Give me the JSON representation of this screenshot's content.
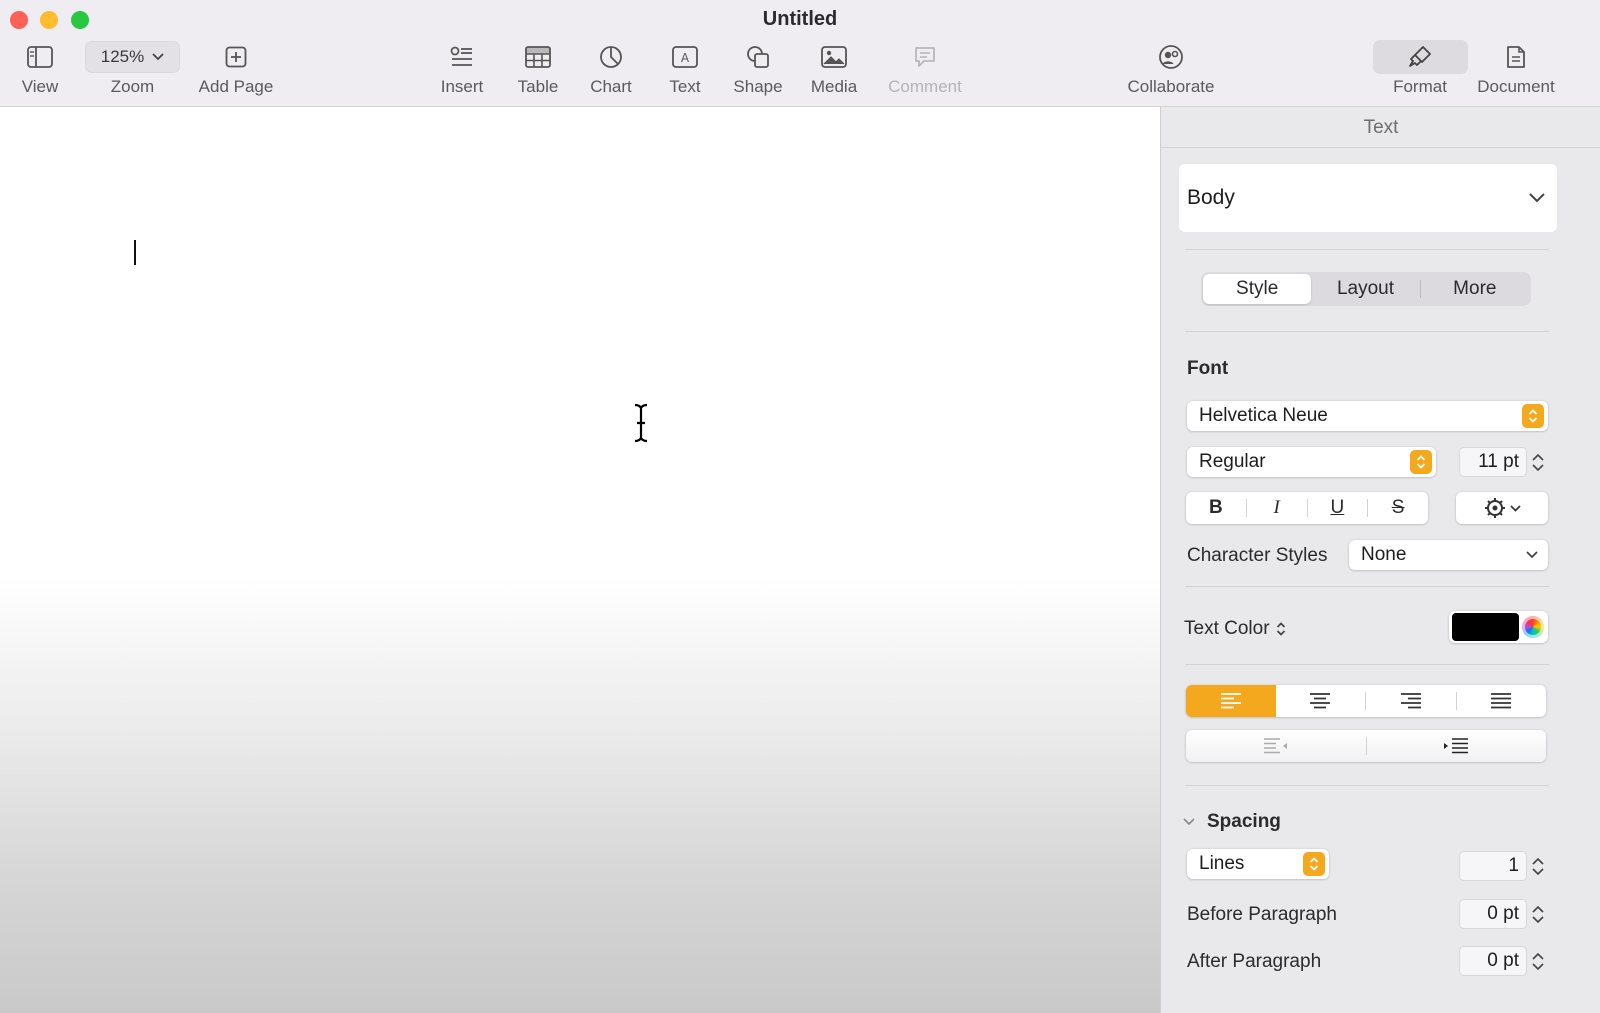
{
  "window": {
    "title": "Untitled"
  },
  "toolbar": {
    "view": "View",
    "zoom_value": "125%",
    "zoom": "Zoom",
    "add_page": "Add Page",
    "insert": "Insert",
    "table": "Table",
    "chart": "Chart",
    "text": "Text",
    "shape": "Shape",
    "media": "Media",
    "comment": "Comment",
    "collaborate": "Collaborate",
    "format": "Format",
    "document": "Document"
  },
  "inspector": {
    "header": "Text",
    "paragraph_style": "Body",
    "tabs": [
      "Style",
      "Layout",
      "More"
    ],
    "active_tab": "Style",
    "font_section": "Font",
    "font_family": "Helvetica Neue",
    "font_typeface": "Regular",
    "font_size": "11 pt",
    "bius": {
      "bold": "B",
      "italic": "I",
      "underline": "U",
      "strike": "S"
    },
    "character_styles_label": "Character Styles",
    "character_styles_value": "None",
    "text_color_label": "Text Color",
    "text_color": "#000000",
    "alignment_active": "left",
    "spacing_label": "Spacing",
    "spacing_mode": "Lines",
    "spacing_value": "1",
    "before_paragraph_label": "Before Paragraph",
    "before_paragraph_value": "0 pt",
    "after_paragraph_label": "After Paragraph",
    "after_paragraph_value": "0 pt"
  },
  "colors": {
    "accent": "#f4a81d",
    "close": "#fe5f57",
    "minimize": "#febc2e",
    "zoom": "#28c840"
  }
}
